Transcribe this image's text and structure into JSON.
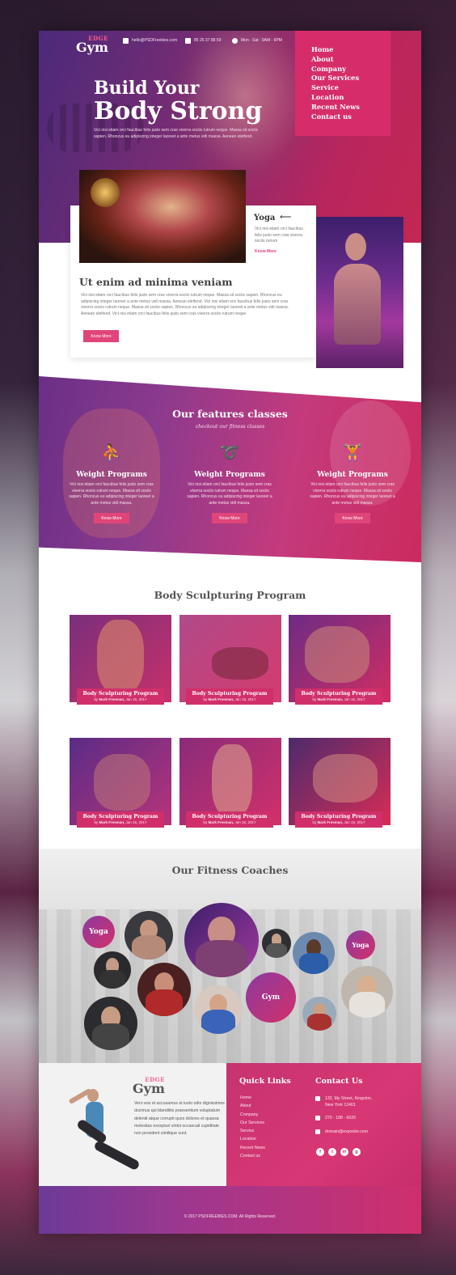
{
  "brand": {
    "edge": "EDGE",
    "gym": "Gym"
  },
  "topbar": {
    "email": "hello@PSDFreebies.com",
    "phone": "85 26 37 88 59",
    "hours": "Mon - Sat : 9AM - 6PM"
  },
  "nav": [
    "Home",
    "About",
    "Company",
    "Our Services",
    "Service",
    "Location",
    "Recent News",
    "Contact us"
  ],
  "hero": {
    "title_line1": "Build Your",
    "title_line2": "Body Strong",
    "text": "Vici nisi etiam orci faucibus felis justo sem cras viverra sociis rutrum neque. Massa sit sociis sapien. Rhoncus eu adipiscing integer laoreet a ante metus vidi massa. Aenean eleifend."
  },
  "intro": {
    "side_title": "Yoga",
    "side_arrow": "⟵",
    "side_text": "Vici nisi etiam orci faucibus felis justo sem cras viverra sociis rutrum",
    "side_more": "Know More",
    "heading": "Ut enim ad minima veniam",
    "body": "Vici nisi etiam orci faucibus felis justo sem cras viverra sociis rutrum neque. Massa sit sociis sapien. Rhoncus eu adipiscing integer laoreet a ante metus vidi massa. Aenean eleifend. Vici nisi etiam orci faucibus felis justo sem cras viverra sociis rutrum neque. Massa sit sociis sapien. Rhoncus eu adipiscing integer laoreet a ante metus vidi massa. Aenean eleifend. Vici nisi etiam orci faucibus felis justo sem cras viverra sociis rutrum neque.",
    "button": "Know More"
  },
  "features": {
    "title": "Our features classes",
    "subtitle": "checkout our fitness classes",
    "items": [
      {
        "name": "Weight Programs",
        "icon": "treadmill-icon",
        "text": "Vici nisi etiam orci faucibus felis justo sem cras viverra sociis rutrum neque. Massa sit sociis sapien. Rhoncus eu adipiscing integer laoreet a ante metus vidi massa.",
        "button": "Know More"
      },
      {
        "name": "Weight Programs",
        "icon": "mat-icon",
        "text": "Vici nisi etiam orci faucibus felis justo sem cras viverra sociis rutrum neque. Massa sit sociis sapien. Rhoncus eu adipiscing integer laoreet a ante metus vidi massa.",
        "button": "Know More"
      },
      {
        "name": "Weight Programs",
        "icon": "weightlifter-icon",
        "text": "Vici nisi etiam orci faucibus felis justo sem cras viverra sociis rutrum neque. Massa sit sociis sapien. Rhoncus eu adipiscing integer laoreet a ante metus vidi massa.",
        "button": "Know More"
      }
    ]
  },
  "program": {
    "heading": "Body Sculpturing Program",
    "items": [
      {
        "title": "Body Sculpturing Program",
        "by": "by",
        "author": "Mark Freeman,",
        "date": "Jan 15, 2017"
      },
      {
        "title": "Body Sculpturing Program",
        "by": "by",
        "author": "Mark Freeman,",
        "date": "Jan 15, 2017"
      },
      {
        "title": "Body Sculpturing Program",
        "by": "by",
        "author": "Mark Freeman,",
        "date": "Jan 15, 2017"
      },
      {
        "title": "Body Sculpturing Program",
        "by": "by",
        "author": "Mark Freeman,",
        "date": "Jan 15, 2017"
      },
      {
        "title": "Body Sculpturing Program",
        "by": "by",
        "author": "Mark Freeman,",
        "date": "Jan 15, 2017"
      },
      {
        "title": "Body Sculpturing Program",
        "by": "by",
        "author": "Mark Freeman,",
        "date": "Jan 15, 2017"
      }
    ]
  },
  "coaches": {
    "heading": "Our Fitness Coaches",
    "labels": [
      "Yoga",
      "Yoga",
      "Gym"
    ]
  },
  "footer": {
    "about": "Vero eos et accusamus et iusto odio dignissimos ducimus qui blanditiis praesentium voluptatum deleniti atque corrupti quos dolores et quassa molestias excepturi sintoi occaecati cupiditate non provident similique sunt.",
    "quick_links_title": "Quick Links",
    "quick_links": [
      "Home",
      "About",
      "Company",
      "Our Services",
      "Service",
      "Location",
      "Recent News",
      "Contact us"
    ],
    "contact_title": "Contact Us",
    "address_line1": "132, My Street, Kingston,",
    "address_line2": "New York 12401",
    "phone": "270 - 188 - 6026",
    "email": "domain@expooler.com",
    "social": [
      "f",
      "t",
      "in",
      "g"
    ],
    "copyright": "© 2017 PSDFREEBIES.COM. All Rights Reserved."
  },
  "colors": {
    "accent": "#e0457a",
    "nav_box": "#d62d6a",
    "caption": "#d02f6b"
  }
}
